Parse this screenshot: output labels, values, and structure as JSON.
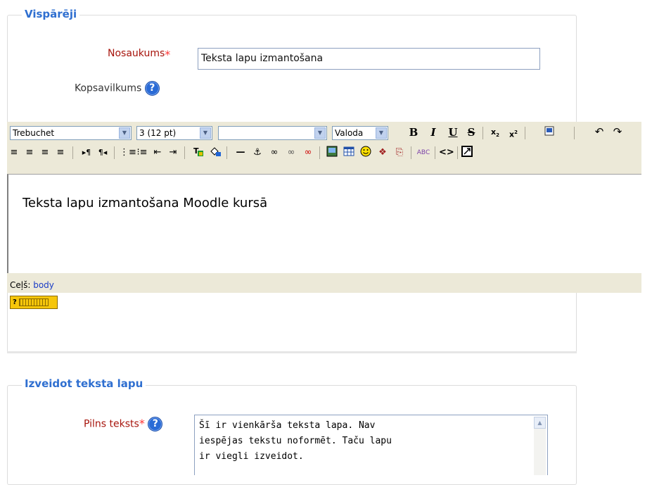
{
  "general": {
    "legend": "Vispārēji",
    "name_label": "Nosaukums",
    "name_value": "Teksta lapu izmantošana",
    "summary_label": "Kopsavilkums"
  },
  "editor": {
    "font_family": "Trebuchet",
    "font_size": "3 (12 pt)",
    "format": "",
    "language": "Valoda",
    "content": "Teksta lapu izmantošana Moodle kursā",
    "path_label": "Ceļš:",
    "path_value": "body"
  },
  "create": {
    "legend": "Izveidot teksta lapu",
    "fulltext_label": "Pilns teksts",
    "fulltext_value": "Šī ir vienkārša teksta lapa. Nav\niespējas tekstu noformēt. Taču lapu\nir viegli izveidot."
  },
  "common": {
    "required_marker": "*",
    "help_glyph": "?"
  }
}
